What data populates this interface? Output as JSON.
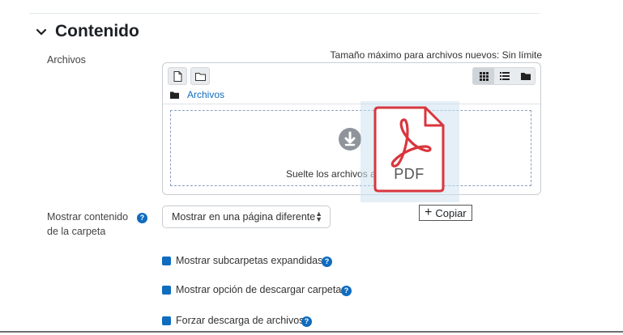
{
  "section": {
    "title": "Contenido",
    "chevron_icon": "chevron-down-icon"
  },
  "files_field": {
    "label": "Archivos",
    "max_size_text": "Tamaño máximo para archivos nuevos: Sin límite",
    "toolbar": {
      "add_file_icon": "file-icon",
      "create_folder_icon": "folder-icon",
      "views": [
        "grid-view-icon",
        "list-view-icon",
        "tree-view-icon"
      ],
      "active_view": "grid-view-icon"
    },
    "breadcrumb": "Archivos",
    "dropzone_text": "Suelte los archivos a subir"
  },
  "drag": {
    "file_label": "PDF",
    "tooltip": "Copiar"
  },
  "display_field": {
    "label_line1": "Mostrar contenido",
    "label_line2": "de la carpeta",
    "selected": "Mostrar en una página diferente"
  },
  "checkboxes": [
    {
      "label": "Mostrar subcarpetas expandidas",
      "checked": true
    },
    {
      "label": "Mostrar opción de descargar carpeta",
      "checked": true
    },
    {
      "label": "Forzar descarga de archivos",
      "checked": true
    }
  ],
  "colors": {
    "accent": "#0f6cbf",
    "pdf_red": "#d9363e"
  }
}
